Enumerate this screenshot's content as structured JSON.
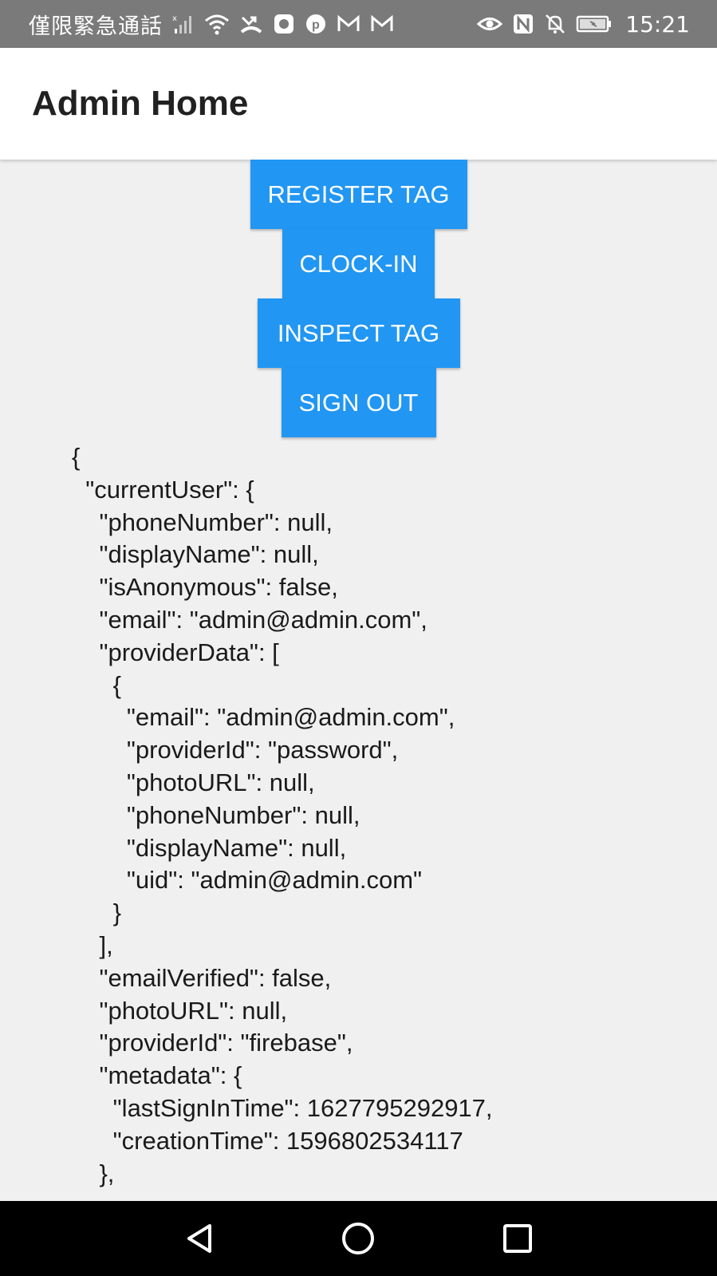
{
  "status_bar": {
    "carrier": "僅限緊急通話",
    "time": "15:21",
    "icons": [
      "no-signal-icon",
      "wifi-icon",
      "missed-call-icon",
      "app-icon",
      "pinterest-icon",
      "gmail-icon",
      "gmail-icon",
      "eye-icon",
      "nfc-icon",
      "notifications-off-icon",
      "battery-charging-icon"
    ]
  },
  "app_bar": {
    "title": "Admin Home"
  },
  "actions": {
    "register_tag": "REGISTER TAG",
    "clock_in": "CLOCK-IN",
    "inspect_tag": "INSPECT TAG",
    "sign_out": "SIGN OUT"
  },
  "user_json": "{\n  \"currentUser\": {\n    \"phoneNumber\": null,\n    \"displayName\": null,\n    \"isAnonymous\": false,\n    \"email\": \"admin@admin.com\",\n    \"providerData\": [\n      {\n        \"email\": \"admin@admin.com\",\n        \"providerId\": \"password\",\n        \"photoURL\": null,\n        \"phoneNumber\": null,\n        \"displayName\": null,\n        \"uid\": \"admin@admin.com\"\n      }\n    ],\n    \"emailVerified\": false,\n    \"photoURL\": null,\n    \"providerId\": \"firebase\",\n    \"metadata\": {\n      \"lastSignInTime\": 1627795292917,\n      \"creationTime\": 1596802534117\n    },",
  "nav": {
    "icons": [
      "back-icon",
      "home-icon",
      "recents-icon"
    ]
  },
  "colors": {
    "accent": "#2196f3",
    "status_bar": "#7a7a7a",
    "nav_bar": "#000000"
  }
}
